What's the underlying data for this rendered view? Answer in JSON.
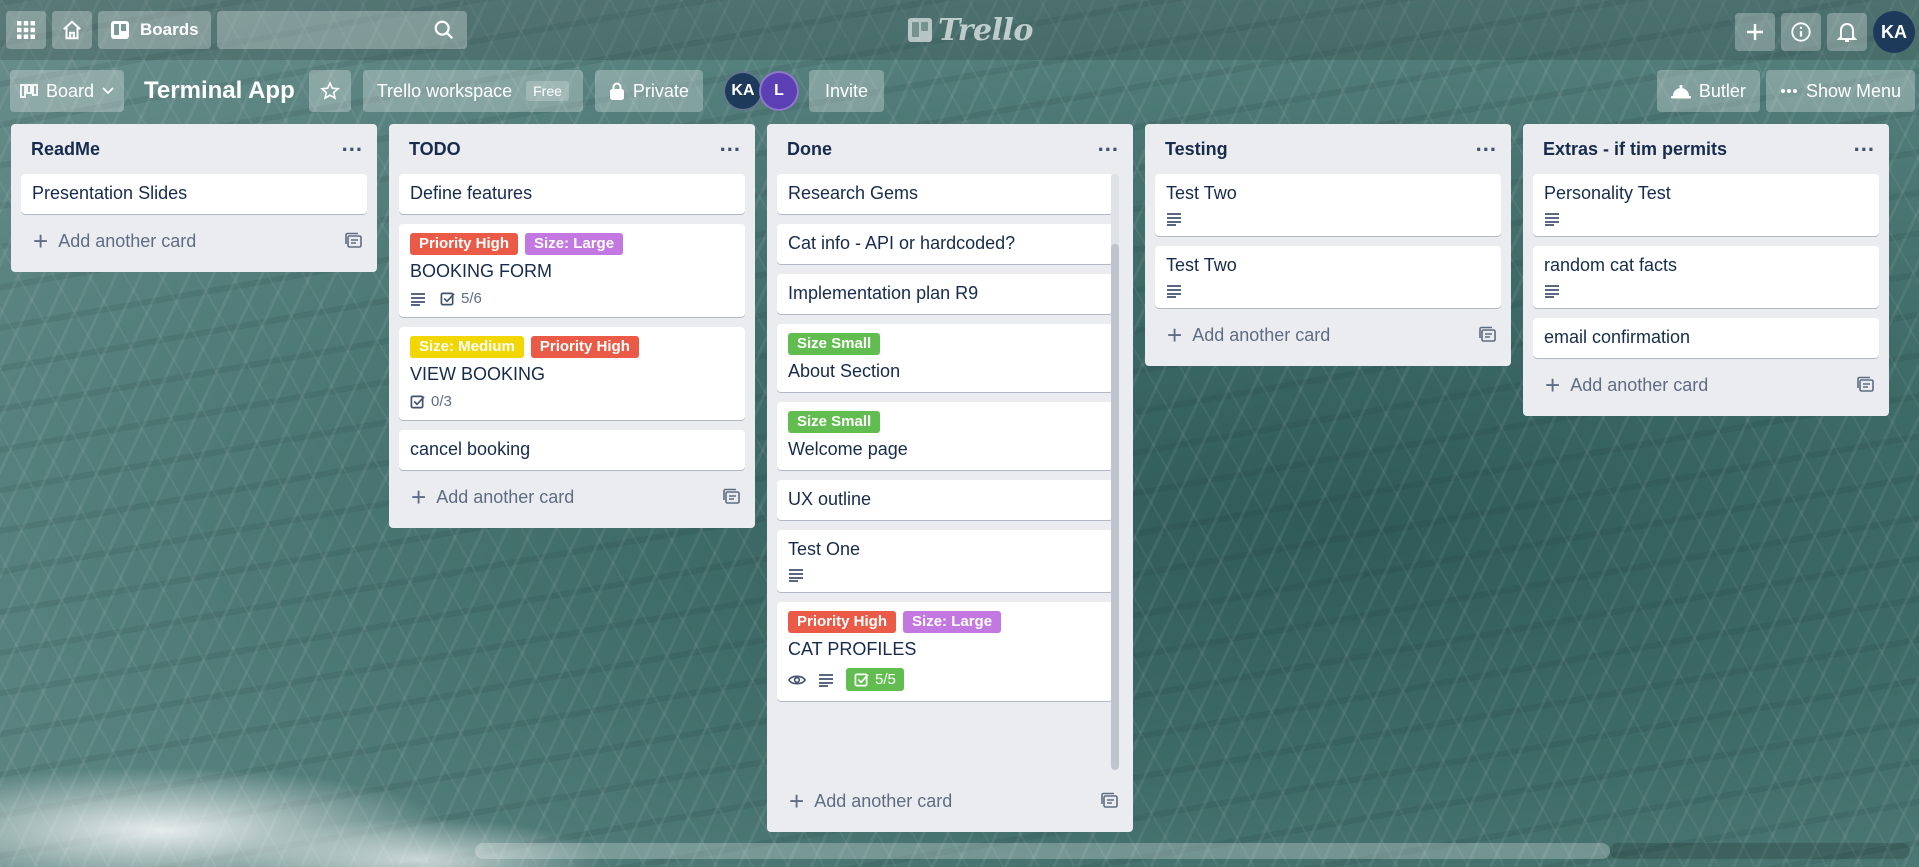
{
  "topbar": {
    "boards_label": "Boards",
    "logo_text": "Trello",
    "avatar_initials": "KA"
  },
  "board": {
    "view_label": "Board",
    "title": "Terminal App",
    "workspace_label": "Trello workspace",
    "workspace_plan": "Free",
    "visibility_label": "Private",
    "members": [
      "KA",
      "L"
    ],
    "invite_label": "Invite",
    "butler_label": "Butler",
    "show_menu_label": "Show Menu"
  },
  "add_card_label": "Add another card",
  "lists": [
    {
      "title": "ReadMe",
      "cards": [
        {
          "title": "Presentation Slides"
        }
      ]
    },
    {
      "title": "TODO",
      "cards": [
        {
          "title": "Define features"
        },
        {
          "title": "BOOKING FORM",
          "labels": [
            {
              "text": "Priority High",
              "color": "#eb5a46"
            },
            {
              "text": "Size: Large",
              "color": "#c377e0"
            }
          ],
          "description": true,
          "checklist": "5/6"
        },
        {
          "title": "VIEW BOOKING",
          "labels": [
            {
              "text": "Size: Medium",
              "color": "#f2d600"
            },
            {
              "text": "Priority High",
              "color": "#eb5a46"
            }
          ],
          "checklist": "0/3"
        },
        {
          "title": "cancel booking"
        }
      ]
    },
    {
      "title": "Done",
      "cards": [
        {
          "title": "Research Gems"
        },
        {
          "title": "Cat info - API or hardcoded?"
        },
        {
          "title": "Implementation plan R9"
        },
        {
          "title": "About Section",
          "labels": [
            {
              "text": "Size Small",
              "color": "#61bd4f"
            }
          ]
        },
        {
          "title": "Welcome page",
          "labels": [
            {
              "text": "Size Small",
              "color": "#61bd4f"
            }
          ]
        },
        {
          "title": "UX outline"
        },
        {
          "title": "Test One",
          "description": true
        },
        {
          "title": "CAT PROFILES",
          "labels": [
            {
              "text": "Priority High",
              "color": "#eb5a46"
            },
            {
              "text": "Size: Large",
              "color": "#c377e0"
            }
          ],
          "watching": true,
          "description": true,
          "checklist": "5/5",
          "checklist_complete": true
        }
      ]
    },
    {
      "title": "Testing",
      "cards": [
        {
          "title": "Test Two",
          "description": true
        },
        {
          "title": "Test Two",
          "description": true
        }
      ]
    },
    {
      "title": "Extras - if tim permits",
      "cards": [
        {
          "title": "Personality Test",
          "description": true
        },
        {
          "title": "random cat facts",
          "description": true
        },
        {
          "title": "email confirmation"
        }
      ]
    }
  ]
}
